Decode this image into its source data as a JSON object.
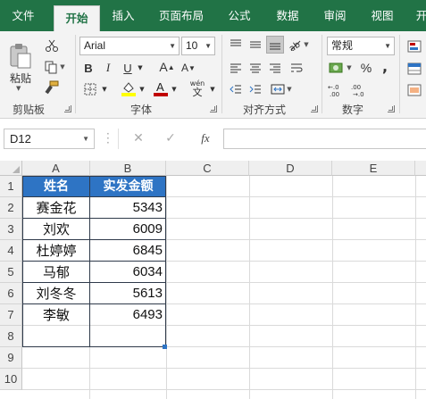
{
  "tabs": [
    "文件",
    "开始",
    "插入",
    "页面布局",
    "公式",
    "数据",
    "审阅",
    "视图",
    "开"
  ],
  "active_tab": "开始",
  "colors": {
    "brand": "#217346",
    "table_header": "#2e74c4"
  },
  "ribbon": {
    "clipboard": {
      "label": "剪贴板",
      "paste_label": "粘贴"
    },
    "font": {
      "label": "字体",
      "font_name": "Arial",
      "font_size": "10",
      "bold": "B",
      "italic": "I",
      "underline": "U",
      "grow": "A",
      "shrink": "A",
      "phonetic": "wén",
      "phonetic_char": "文"
    },
    "alignment": {
      "label": "对齐方式"
    },
    "number": {
      "label": "数字",
      "format": "常规",
      "percent": "%",
      "comma": ","
    }
  },
  "formula_bar": {
    "name_box": "D12",
    "fx": "fx",
    "formula": ""
  },
  "sheet": {
    "columns": [
      "A",
      "B",
      "C",
      "D",
      "E"
    ],
    "rows": [
      "1",
      "2",
      "3",
      "4",
      "5",
      "6",
      "7",
      "8",
      "9",
      "10"
    ],
    "headers": {
      "name": "姓名",
      "amount": "实发金额"
    },
    "records": [
      {
        "name": "赛金花",
        "amount": "5343"
      },
      {
        "name": "刘欢",
        "amount": "6009"
      },
      {
        "name": "杜婷婷",
        "amount": "6845"
      },
      {
        "name": "马郁",
        "amount": "6034"
      },
      {
        "name": "刘冬冬",
        "amount": "5613"
      },
      {
        "name": "李敏",
        "amount": "6493"
      }
    ]
  }
}
